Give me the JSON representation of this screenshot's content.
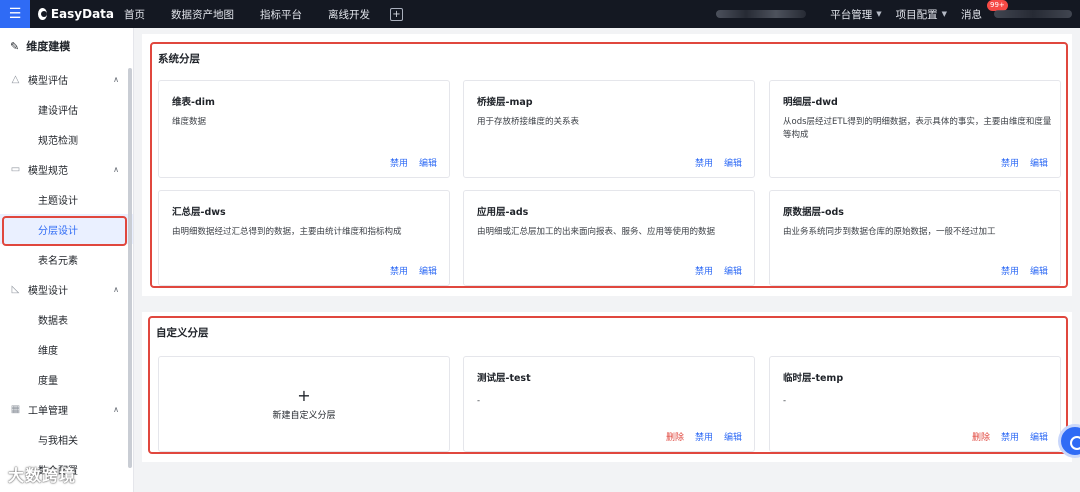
{
  "topbar": {
    "logo_text": "EasyData",
    "nav": [
      "首页",
      "数据资产地图",
      "指标平台",
      "离线开发"
    ],
    "right_menus": [
      "平台管理",
      "项目配置"
    ],
    "message_label": "消息",
    "message_badge": "99+"
  },
  "sidebar": {
    "title": "维度建模",
    "groups": [
      {
        "label": "模型评估",
        "items": [
          "建设评估",
          "规范检测"
        ]
      },
      {
        "label": "模型规范",
        "items": [
          "主题设计",
          "分层设计",
          "表名元素"
        ]
      },
      {
        "label": "模型设计",
        "items": [
          "数据表",
          "维度",
          "度量"
        ]
      },
      {
        "label": "工单管理",
        "items": [
          "与我相关",
          "数仓配置"
        ]
      }
    ],
    "active_item": "分层设计",
    "brand_watermark": "大数跨境"
  },
  "system_layers": {
    "title": "系统分层",
    "cards": [
      {
        "name": "维表-dim",
        "desc": "维度数据",
        "actions": [
          "禁用",
          "编辑"
        ]
      },
      {
        "name": "桥接层-map",
        "desc": "用于存放桥接维度的关系表",
        "actions": [
          "禁用",
          "编辑"
        ]
      },
      {
        "name": "明细层-dwd",
        "desc": "从ods层经过ETL得到的明细数据，表示具体的事实，主要由维度和度量等构成",
        "actions": [
          "禁用",
          "编辑"
        ]
      },
      {
        "name": "汇总层-dws",
        "desc": "由明细数据经过汇总得到的数据，主要由统计维度和指标构成",
        "actions": [
          "禁用",
          "编辑"
        ]
      },
      {
        "name": "应用层-ads",
        "desc": "由明细或汇总层加工的出来面向报表、服务、应用等使用的数据",
        "actions": [
          "禁用",
          "编辑"
        ]
      },
      {
        "name": "原数据层-ods",
        "desc": "由业务系统同步到数据仓库的原始数据，一般不经过加工",
        "actions": [
          "禁用",
          "编辑"
        ]
      }
    ]
  },
  "custom_layers": {
    "title": "自定义分层",
    "new_label": "新建自定义分层",
    "cards": [
      {
        "name": "测试层-test",
        "desc": "-",
        "actions": [
          "删除",
          "禁用",
          "编辑"
        ]
      },
      {
        "name": "临时层-temp",
        "desc": "-",
        "actions": [
          "删除",
          "禁用",
          "编辑"
        ]
      }
    ]
  },
  "colors": {
    "accent": "#2f6bf5",
    "danger": "#e0473e",
    "topbar": "#141822"
  }
}
